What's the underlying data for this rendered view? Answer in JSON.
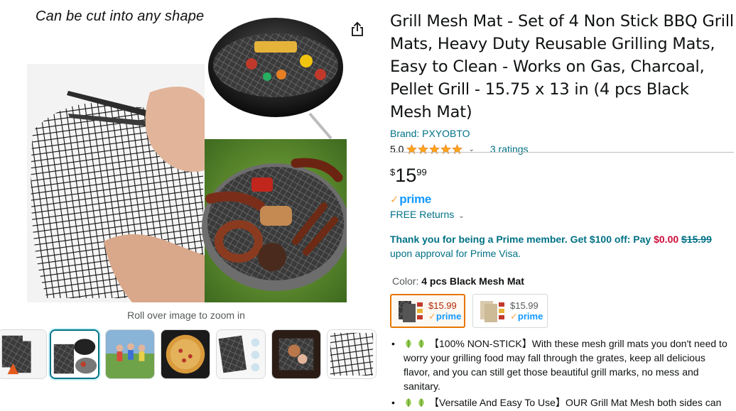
{
  "gallery": {
    "image_caption": "Can be cut into any shape",
    "zoom_hint": "Roll over image to zoom in"
  },
  "product": {
    "title": "Grill Mesh Mat - Set of 4 Non Stick BBQ Grill Mats, Heavy Duty Reusable Grilling Mats, Easy to Clean - Works on Gas, Charcoal, Pellet Grill - 15.75 x 13 in (4 pcs Black Mesh Mat)",
    "brand": "Brand: PXYOBTO",
    "rating": "5.0",
    "ratings_count": "3 ratings",
    "star_fill": 1.0
  },
  "price": {
    "symbol": "$",
    "whole": "15",
    "fraction": "99"
  },
  "prime": {
    "label": "prime",
    "free_returns": "FREE Returns"
  },
  "promo": {
    "lead": "Thank you for being a Prime member. Get $100 off: Pay ",
    "pay_amount": "$0.00",
    "strike_amount": "$15.99",
    "sub": "upon approval for Prime Visa."
  },
  "color": {
    "label": "Color: ",
    "selected": "4 pcs Black Mesh Mat",
    "swatches": [
      {
        "price": "$15.99",
        "prime": "prime",
        "selected": true
      },
      {
        "price": "$15.99",
        "prime": "prime",
        "selected": false
      }
    ]
  },
  "bullets": [
    "【100% NON-STICK】With these mesh grill mats you don't need to worry your grilling food may fall through the grates, keep all delicious flavor, and you can still get those beautiful grill marks, no mess and sanitary.",
    "【Versatile And Easy To Use】OUR Grill Mat Mesh both sides can"
  ],
  "colors": {
    "link": "#007185",
    "price_red": "#b12704",
    "prime_blue": "#1399ff",
    "star": "#ffa41c",
    "selected_border": "#e77600"
  }
}
